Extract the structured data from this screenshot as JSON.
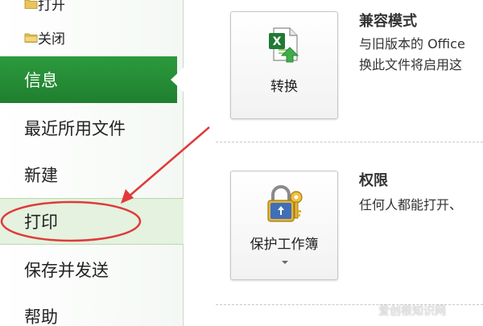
{
  "sidebar": {
    "open_label": "打开",
    "close_label": "关闭",
    "items": [
      {
        "label": "信息"
      },
      {
        "label": "最近所用文件"
      },
      {
        "label": "新建"
      },
      {
        "label": "打印"
      },
      {
        "label": "保存并发送"
      },
      {
        "label": "帮助"
      }
    ]
  },
  "compat": {
    "title": "兼容模式",
    "desc_line1": "与旧版本的 Office",
    "desc_line2": "换此文件将启用这",
    "button_label": "转换"
  },
  "permissions": {
    "title": "权限",
    "desc_line1": "任何人都能打开、",
    "button_label": "保护工作簿"
  },
  "watermark": "爱创根知识网",
  "colors": {
    "selected_nav": "#2c9a3d",
    "hover_nav": "#e4f2df",
    "annotation": "#e03a3a"
  }
}
